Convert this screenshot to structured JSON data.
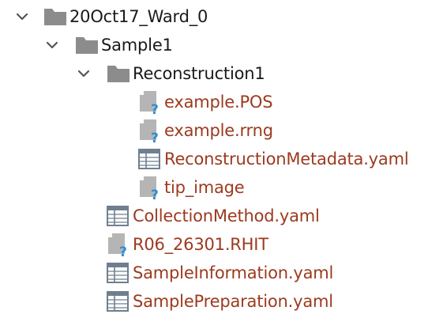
{
  "colors": {
    "folder_text": "#1a1a1a",
    "file_text": "#9c3a1f",
    "folder_icon": "#8c8c8c",
    "unknown_badge": "#2a8fd6",
    "table_icon": "#6f7f8f"
  },
  "tree": {
    "items": [
      {
        "label": "20Oct17_Ward_0",
        "icon": "folder-icon",
        "expanded": true
      },
      {
        "label": "Sample1",
        "icon": "folder-icon",
        "expanded": true
      },
      {
        "label": "Reconstruction1",
        "icon": "folder-icon",
        "expanded": true
      },
      {
        "label": "example.POS",
        "icon": "unknown-file-icon"
      },
      {
        "label": "example.rrng",
        "icon": "unknown-file-icon"
      },
      {
        "label": "ReconstructionMetadata.yaml",
        "icon": "table-file-icon"
      },
      {
        "label": "tip_image",
        "icon": "unknown-file-icon"
      },
      {
        "label": "CollectionMethod.yaml",
        "icon": "table-file-icon"
      },
      {
        "label": "R06_26301.RHIT",
        "icon": "unknown-file-icon"
      },
      {
        "label": "SampleInformation.yaml",
        "icon": "table-file-icon"
      },
      {
        "label": "SamplePreparation.yaml",
        "icon": "table-file-icon"
      }
    ]
  }
}
